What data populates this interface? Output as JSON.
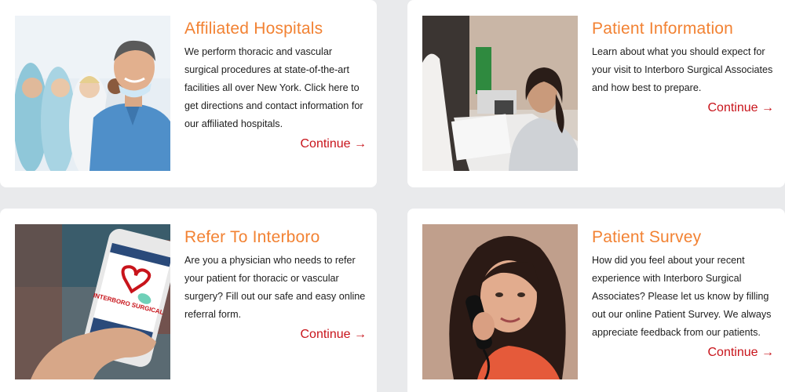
{
  "cards": [
    {
      "title": "Affiliated Hospitals",
      "description": "We perform thoracic and vascular surgical procedures at state-of-the-art facilities all over New York. Click here to get directions and contact information for our affiliated hospitals.",
      "link_label": "Continue →"
    },
    {
      "title": "Patient Information",
      "description": "Learn about what you should expect for your visit to Interboro Surgical Associates and how best to prepare.",
      "link_label": "Continue →"
    },
    {
      "title": "Refer To Interboro",
      "description": "Are you a physician who needs to refer your patient for thoracic or vascular surgery? Fill out our safe and easy online referral form.",
      "link_label": "Continue →"
    },
    {
      "title": "Patient Survey",
      "description": "How did you feel about your recent experience with Interboro Surgical Associates? Please let us know by filling out our online Patient Survey. We always appreciate feedback from our patients.",
      "link_label": "Continue →"
    }
  ],
  "phone_logo_text": "INTERBORO SURGICAL",
  "colors": {
    "title_accent": "#f28233",
    "link": "#c8141b",
    "background": "#e9eaec",
    "card": "#ffffff"
  }
}
